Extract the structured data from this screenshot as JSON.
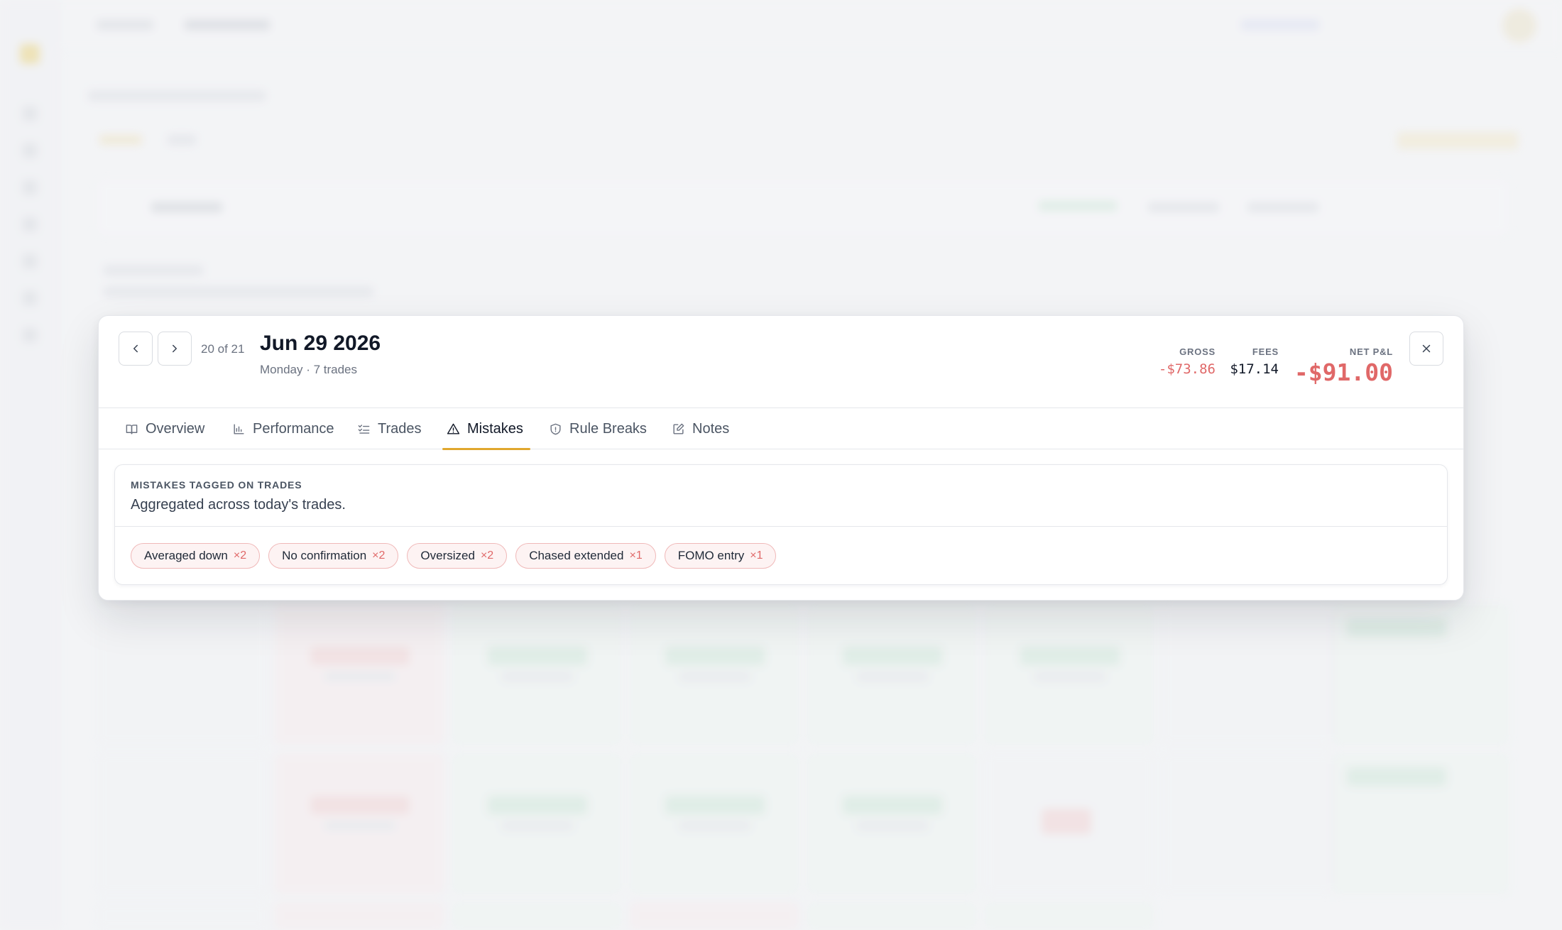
{
  "navigation": {
    "counter": "20 of 21"
  },
  "day": {
    "title": "Jun 29 2026",
    "subtitle": "Monday · 7 trades"
  },
  "stats": {
    "gross_label": "GROSS",
    "gross_value": "-$73.86",
    "fees_label": "FEES",
    "fees_value": "$17.14",
    "net_label": "NET P&L",
    "net_value": "-$91.00",
    "negative_color": "#e06868"
  },
  "tabs": [
    {
      "label": "Overview",
      "icon": "book-open-icon"
    },
    {
      "label": "Performance",
      "icon": "bar-chart-icon"
    },
    {
      "label": "Trades",
      "icon": "list-check-icon"
    },
    {
      "label": "Mistakes",
      "icon": "alert-triangle-icon"
    },
    {
      "label": "Rule Breaks",
      "icon": "shield-icon"
    },
    {
      "label": "Notes",
      "icon": "edit-note-icon"
    }
  ],
  "active_tab": "Mistakes",
  "accent_color": "#e0a72e",
  "mistakes": {
    "eyebrow": "MISTAKES TAGGED ON TRADES",
    "description": "Aggregated across today's trades.",
    "items": [
      {
        "label": "Averaged down",
        "count": "×2"
      },
      {
        "label": "No confirmation",
        "count": "×2"
      },
      {
        "label": "Oversized",
        "count": "×2"
      },
      {
        "label": "Chased extended",
        "count": "×1"
      },
      {
        "label": "FOMO entry",
        "count": "×1"
      }
    ]
  }
}
